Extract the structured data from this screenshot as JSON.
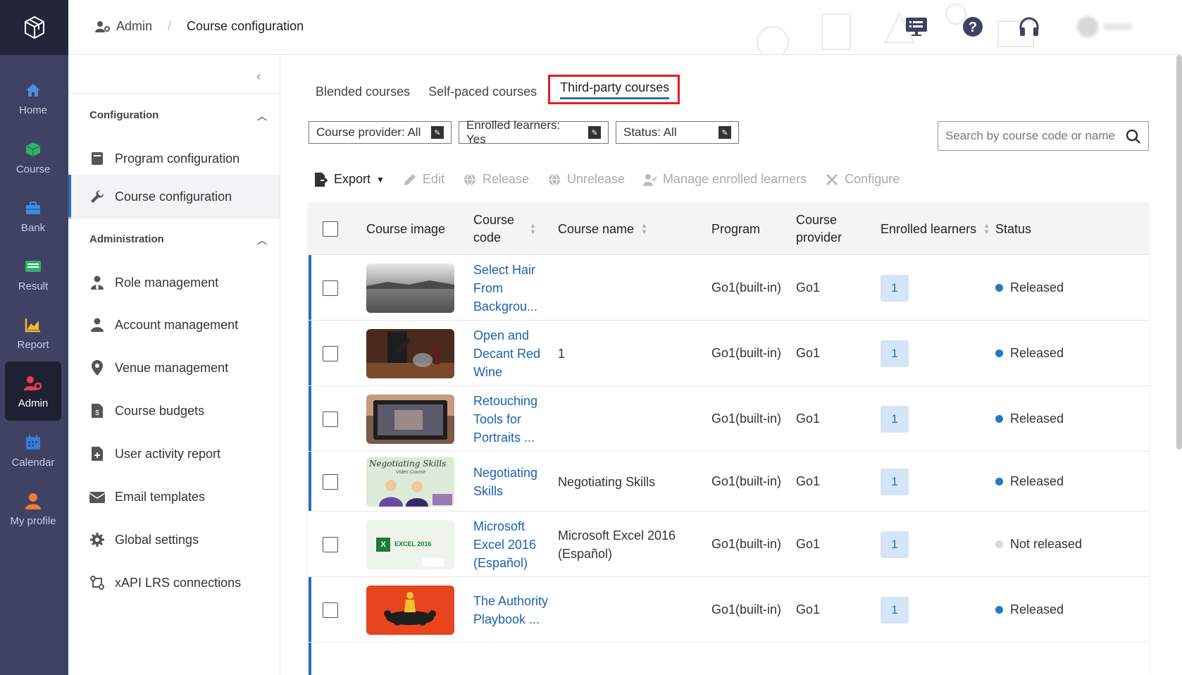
{
  "rail": {
    "items": [
      {
        "label": "Home",
        "icon": "home-icon"
      },
      {
        "label": "Course",
        "icon": "course-icon"
      },
      {
        "label": "Bank",
        "icon": "bank-icon"
      },
      {
        "label": "Result",
        "icon": "result-icon"
      },
      {
        "label": "Report",
        "icon": "report-icon"
      },
      {
        "label": "Admin",
        "icon": "admin-icon"
      },
      {
        "label": "Calendar",
        "icon": "calendar-icon"
      },
      {
        "label": "My profile",
        "icon": "profile-icon"
      }
    ],
    "active": "Admin"
  },
  "header": {
    "breadcrumb_root": "Admin",
    "breadcrumb_sep": "/",
    "breadcrumb_current": "Course configuration"
  },
  "side": {
    "sections": [
      {
        "title": "Configuration"
      },
      {
        "title": "Administration"
      }
    ],
    "items": [
      {
        "label": "Program configuration",
        "icon": "book-icon"
      },
      {
        "label": "Course configuration",
        "icon": "wrench-icon"
      },
      {
        "label": "Role management",
        "icon": "user-tie-icon"
      },
      {
        "label": "Account management",
        "icon": "user-icon"
      },
      {
        "label": "Venue management",
        "icon": "location-pin-icon"
      },
      {
        "label": "Course budgets",
        "icon": "file-dollar-icon"
      },
      {
        "label": "User activity report",
        "icon": "file-plus-icon"
      },
      {
        "label": "Email templates",
        "icon": "envelope-icon"
      },
      {
        "label": "Global settings",
        "icon": "gear-icon"
      },
      {
        "label": "xAPI LRS connections",
        "icon": "connection-icon"
      }
    ]
  },
  "tabs": [
    "Blended courses",
    "Self-paced courses",
    "Third-party courses"
  ],
  "filters": [
    "Course provider: All",
    "Enrolled learners: Yes",
    "Status: All"
  ],
  "search": {
    "placeholder": "Search by course code or name"
  },
  "toolbar": {
    "export": "Export",
    "edit": "Edit",
    "release": "Release",
    "unrelease": "Unrelease",
    "manage": "Manage enrolled learners",
    "configure": "Configure"
  },
  "table": {
    "headers": {
      "image": "Course image",
      "code": "Course code",
      "name": "Course name",
      "program": "Program",
      "provider": "Course provider",
      "enrolled": "Enrolled learners",
      "status": "Status"
    },
    "rows": [
      {
        "code": "Select Hair From Backgrou...",
        "name": "",
        "program": "Go1(built-in)",
        "provider": "Go1",
        "enrolled": "1",
        "status": "Released",
        "status_color": "#1f78c8"
      },
      {
        "code": "Open and Decant Red Wine",
        "name": "1",
        "program": "Go1(built-in)",
        "provider": "Go1",
        "enrolled": "1",
        "status": "Released",
        "status_color": "#1f78c8"
      },
      {
        "code": "Retouching Tools for Portraits ...",
        "name": "",
        "program": "Go1(built-in)",
        "provider": "Go1",
        "enrolled": "1",
        "status": "Released",
        "status_color": "#1f78c8"
      },
      {
        "code": "Negotiating Skills",
        "name": "Negotiating Skills",
        "program": "Go1(built-in)",
        "provider": "Go1",
        "enrolled": "1",
        "status": "Released",
        "status_color": "#1f78c8"
      },
      {
        "code": "Microsoft Excel 2016 (Español)",
        "name": "Microsoft Excel 2016 (Español)",
        "program": "Go1(built-in)",
        "provider": "Go1",
        "enrolled": "1",
        "status": "Not released",
        "status_color": "#d9d9d9"
      },
      {
        "code": "The Authority Playbook ...",
        "name": "",
        "program": "Go1(built-in)",
        "provider": "Go1",
        "enrolled": "1",
        "status": "Released",
        "status_color": "#1f78c8"
      }
    ],
    "thumb_texts": {
      "neg_title": "Negotiating Skills",
      "neg_sub": "Video Course",
      "excel": "EXCEL 2016"
    }
  },
  "colors": {
    "accent": "#2f6db5",
    "rail": "#3f4262",
    "highlight": "#e02020"
  }
}
